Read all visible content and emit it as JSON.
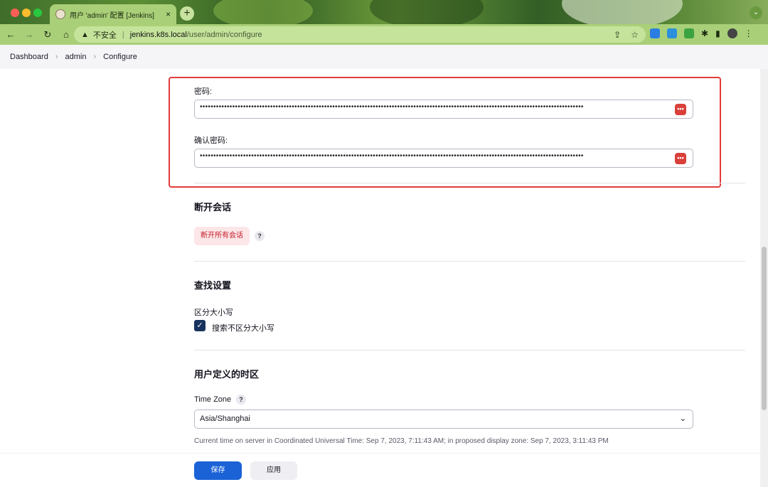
{
  "browser": {
    "tab_title": "用户 'admin' 配置 [Jenkins]",
    "url_warning": "不安全",
    "url_host": "jenkins.k8s.local",
    "url_path": "/user/admin/configure"
  },
  "breadcrumb": [
    "Dashboard",
    "admin",
    "Configure"
  ],
  "password": {
    "label": "密码:",
    "confirm_label": "确认密码:",
    "dots": "••••••••••••••••••••••••••••••••••••••••••••••••••••••••••••••••••••••••••••••••••••••••••••••••••••••••••••••••••••••••••••••••••••••••••••••"
  },
  "sessions": {
    "title": "断开会话",
    "button": "断开所有会话"
  },
  "search": {
    "title": "查找设置",
    "label": "区分大小写",
    "checkbox_label": "搜索不区分大小写",
    "checked": true
  },
  "timezone": {
    "title": "用户定义的时区",
    "label": "Time Zone",
    "value": "Asia/Shanghai",
    "note": "Current time on server in Coordinated Universal Time: Sep 7, 2023, 7:11:43 AM; in proposed display zone: Sep 7, 2023, 3:11:43 PM"
  },
  "actions": {
    "save": "保存",
    "apply": "应用"
  },
  "help_glyph": "?"
}
